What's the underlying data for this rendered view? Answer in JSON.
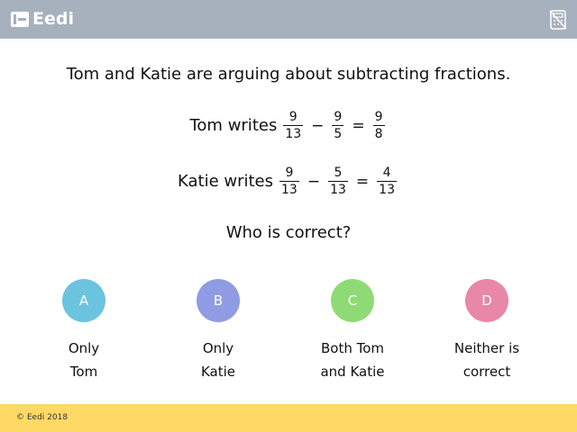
{
  "header": {
    "brand": "Eedi",
    "calculator_icon": "no-calculator-icon"
  },
  "question": {
    "line1": "Tom and Katie are arguing about subtracting fractions.",
    "tom": {
      "label": "Tom writes",
      "a_num": "9",
      "a_den": "13",
      "op": "−",
      "b_num": "9",
      "b_den": "5",
      "eq": "=",
      "c_num": "9",
      "c_den": "8"
    },
    "katie": {
      "label": "Katie writes",
      "a_num": "9",
      "a_den": "13",
      "op": "−",
      "b_num": "5",
      "b_den": "13",
      "eq": "=",
      "c_num": "4",
      "c_den": "13"
    },
    "prompt": "Who is correct?"
  },
  "options": [
    {
      "letter": "A",
      "line1": "Only",
      "line2": "Tom",
      "color": "#6cc3e0"
    },
    {
      "letter": "B",
      "line1": "Only",
      "line2": "Katie",
      "color": "#8f9be3"
    },
    {
      "letter": "C",
      "line1": "Both Tom",
      "line2": "and Katie",
      "color": "#8edb76"
    },
    {
      "letter": "D",
      "line1": "Neither is",
      "line2": "correct",
      "color": "#e987a8"
    }
  ],
  "footer": {
    "copyright": "© Eedi 2018"
  }
}
